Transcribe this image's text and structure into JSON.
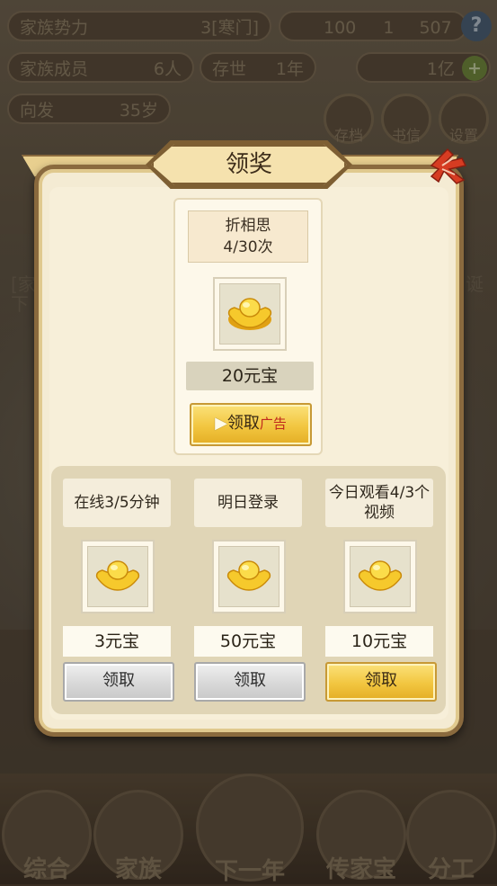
{
  "background": {
    "family_power_label": "家族势力",
    "family_power_value": "3[寒门]",
    "currency_line": "100",
    "currency_a": "1",
    "currency_b": "507",
    "help_label": "?",
    "members_label": "家族成员",
    "members_value": "6人",
    "alive_label": "存世",
    "alive_value": "1年",
    "gold_value": "1亿",
    "gold_add_label": "+",
    "direction_label": "向发",
    "direction_value": "35岁",
    "menu_buttons": [
      "存档",
      "书信",
      "设置"
    ],
    "log_lines": [
      "[家",
      "下"
    ],
    "log_right": "诞",
    "nav_items": [
      "综合",
      "家族",
      "下一年",
      "传家宝",
      "分工"
    ]
  },
  "dialog": {
    "title": "领奖",
    "top_reward": {
      "label_line1": "折相思",
      "label_line2": "4/30次",
      "amount": "20元宝",
      "button_label": "领取",
      "button_tag": "广告",
      "play_icon": "▶"
    },
    "tasks": [
      {
        "label": "在线3/5分钟",
        "amount": "3元宝",
        "button_label": "领取",
        "state": "disabled"
      },
      {
        "label": "明日登录",
        "amount": "50元宝",
        "button_label": "领取",
        "state": "disabled"
      },
      {
        "label": "今日观看4/3个视频",
        "amount": "10元宝",
        "button_label": "领取",
        "state": "active"
      }
    ]
  },
  "colors": {
    "gold_button": "#f2c640",
    "ad_tag": "#c0281e",
    "dialog_border": "#8a6a3e",
    "close_ribbon": "#d63c22"
  },
  "icons": {
    "reward": "gold-ingot-icon",
    "close": "close-ribbon-icon",
    "play": "play-icon"
  }
}
